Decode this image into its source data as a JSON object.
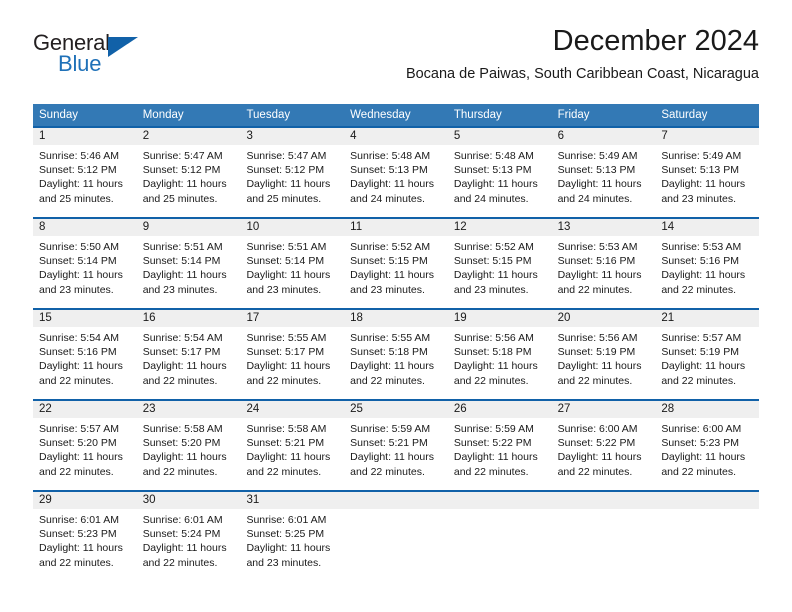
{
  "brand": {
    "name_top": "General",
    "name_bottom": "Blue",
    "accent_color": "#1161a8",
    "text_color": "#231f20"
  },
  "header": {
    "title": "December 2024",
    "subtitle": "Bocana de Paiwas, South Caribbean Coast, Nicaragua"
  },
  "theme": {
    "header_blue": "#3379b5",
    "rule_blue": "#1161a8",
    "daynum_band": "#efefef"
  },
  "weekdays": [
    "Sunday",
    "Monday",
    "Tuesday",
    "Wednesday",
    "Thursday",
    "Friday",
    "Saturday"
  ],
  "weeks": [
    {
      "days": [
        {
          "num": "1",
          "sunrise": "Sunrise: 5:46 AM",
          "sunset": "Sunset: 5:12 PM",
          "daylight1": "Daylight: 11 hours",
          "daylight2": "and 25 minutes."
        },
        {
          "num": "2",
          "sunrise": "Sunrise: 5:47 AM",
          "sunset": "Sunset: 5:12 PM",
          "daylight1": "Daylight: 11 hours",
          "daylight2": "and 25 minutes."
        },
        {
          "num": "3",
          "sunrise": "Sunrise: 5:47 AM",
          "sunset": "Sunset: 5:12 PM",
          "daylight1": "Daylight: 11 hours",
          "daylight2": "and 25 minutes."
        },
        {
          "num": "4",
          "sunrise": "Sunrise: 5:48 AM",
          "sunset": "Sunset: 5:13 PM",
          "daylight1": "Daylight: 11 hours",
          "daylight2": "and 24 minutes."
        },
        {
          "num": "5",
          "sunrise": "Sunrise: 5:48 AM",
          "sunset": "Sunset: 5:13 PM",
          "daylight1": "Daylight: 11 hours",
          "daylight2": "and 24 minutes."
        },
        {
          "num": "6",
          "sunrise": "Sunrise: 5:49 AM",
          "sunset": "Sunset: 5:13 PM",
          "daylight1": "Daylight: 11 hours",
          "daylight2": "and 24 minutes."
        },
        {
          "num": "7",
          "sunrise": "Sunrise: 5:49 AM",
          "sunset": "Sunset: 5:13 PM",
          "daylight1": "Daylight: 11 hours",
          "daylight2": "and 23 minutes."
        }
      ]
    },
    {
      "days": [
        {
          "num": "8",
          "sunrise": "Sunrise: 5:50 AM",
          "sunset": "Sunset: 5:14 PM",
          "daylight1": "Daylight: 11 hours",
          "daylight2": "and 23 minutes."
        },
        {
          "num": "9",
          "sunrise": "Sunrise: 5:51 AM",
          "sunset": "Sunset: 5:14 PM",
          "daylight1": "Daylight: 11 hours",
          "daylight2": "and 23 minutes."
        },
        {
          "num": "10",
          "sunrise": "Sunrise: 5:51 AM",
          "sunset": "Sunset: 5:14 PM",
          "daylight1": "Daylight: 11 hours",
          "daylight2": "and 23 minutes."
        },
        {
          "num": "11",
          "sunrise": "Sunrise: 5:52 AM",
          "sunset": "Sunset: 5:15 PM",
          "daylight1": "Daylight: 11 hours",
          "daylight2": "and 23 minutes."
        },
        {
          "num": "12",
          "sunrise": "Sunrise: 5:52 AM",
          "sunset": "Sunset: 5:15 PM",
          "daylight1": "Daylight: 11 hours",
          "daylight2": "and 23 minutes."
        },
        {
          "num": "13",
          "sunrise": "Sunrise: 5:53 AM",
          "sunset": "Sunset: 5:16 PM",
          "daylight1": "Daylight: 11 hours",
          "daylight2": "and 22 minutes."
        },
        {
          "num": "14",
          "sunrise": "Sunrise: 5:53 AM",
          "sunset": "Sunset: 5:16 PM",
          "daylight1": "Daylight: 11 hours",
          "daylight2": "and 22 minutes."
        }
      ]
    },
    {
      "days": [
        {
          "num": "15",
          "sunrise": "Sunrise: 5:54 AM",
          "sunset": "Sunset: 5:16 PM",
          "daylight1": "Daylight: 11 hours",
          "daylight2": "and 22 minutes."
        },
        {
          "num": "16",
          "sunrise": "Sunrise: 5:54 AM",
          "sunset": "Sunset: 5:17 PM",
          "daylight1": "Daylight: 11 hours",
          "daylight2": "and 22 minutes."
        },
        {
          "num": "17",
          "sunrise": "Sunrise: 5:55 AM",
          "sunset": "Sunset: 5:17 PM",
          "daylight1": "Daylight: 11 hours",
          "daylight2": "and 22 minutes."
        },
        {
          "num": "18",
          "sunrise": "Sunrise: 5:55 AM",
          "sunset": "Sunset: 5:18 PM",
          "daylight1": "Daylight: 11 hours",
          "daylight2": "and 22 minutes."
        },
        {
          "num": "19",
          "sunrise": "Sunrise: 5:56 AM",
          "sunset": "Sunset: 5:18 PM",
          "daylight1": "Daylight: 11 hours",
          "daylight2": "and 22 minutes."
        },
        {
          "num": "20",
          "sunrise": "Sunrise: 5:56 AM",
          "sunset": "Sunset: 5:19 PM",
          "daylight1": "Daylight: 11 hours",
          "daylight2": "and 22 minutes."
        },
        {
          "num": "21",
          "sunrise": "Sunrise: 5:57 AM",
          "sunset": "Sunset: 5:19 PM",
          "daylight1": "Daylight: 11 hours",
          "daylight2": "and 22 minutes."
        }
      ]
    },
    {
      "days": [
        {
          "num": "22",
          "sunrise": "Sunrise: 5:57 AM",
          "sunset": "Sunset: 5:20 PM",
          "daylight1": "Daylight: 11 hours",
          "daylight2": "and 22 minutes."
        },
        {
          "num": "23",
          "sunrise": "Sunrise: 5:58 AM",
          "sunset": "Sunset: 5:20 PM",
          "daylight1": "Daylight: 11 hours",
          "daylight2": "and 22 minutes."
        },
        {
          "num": "24",
          "sunrise": "Sunrise: 5:58 AM",
          "sunset": "Sunset: 5:21 PM",
          "daylight1": "Daylight: 11 hours",
          "daylight2": "and 22 minutes."
        },
        {
          "num": "25",
          "sunrise": "Sunrise: 5:59 AM",
          "sunset": "Sunset: 5:21 PM",
          "daylight1": "Daylight: 11 hours",
          "daylight2": "and 22 minutes."
        },
        {
          "num": "26",
          "sunrise": "Sunrise: 5:59 AM",
          "sunset": "Sunset: 5:22 PM",
          "daylight1": "Daylight: 11 hours",
          "daylight2": "and 22 minutes."
        },
        {
          "num": "27",
          "sunrise": "Sunrise: 6:00 AM",
          "sunset": "Sunset: 5:22 PM",
          "daylight1": "Daylight: 11 hours",
          "daylight2": "and 22 minutes."
        },
        {
          "num": "28",
          "sunrise": "Sunrise: 6:00 AM",
          "sunset": "Sunset: 5:23 PM",
          "daylight1": "Daylight: 11 hours",
          "daylight2": "and 22 minutes."
        }
      ]
    },
    {
      "days": [
        {
          "num": "29",
          "sunrise": "Sunrise: 6:01 AM",
          "sunset": "Sunset: 5:23 PM",
          "daylight1": "Daylight: 11 hours",
          "daylight2": "and 22 minutes."
        },
        {
          "num": "30",
          "sunrise": "Sunrise: 6:01 AM",
          "sunset": "Sunset: 5:24 PM",
          "daylight1": "Daylight: 11 hours",
          "daylight2": "and 22 minutes."
        },
        {
          "num": "31",
          "sunrise": "Sunrise: 6:01 AM",
          "sunset": "Sunset: 5:25 PM",
          "daylight1": "Daylight: 11 hours",
          "daylight2": "and 23 minutes."
        },
        {
          "num": "",
          "sunrise": "",
          "sunset": "",
          "daylight1": "",
          "daylight2": ""
        },
        {
          "num": "",
          "sunrise": "",
          "sunset": "",
          "daylight1": "",
          "daylight2": ""
        },
        {
          "num": "",
          "sunrise": "",
          "sunset": "",
          "daylight1": "",
          "daylight2": ""
        },
        {
          "num": "",
          "sunrise": "",
          "sunset": "",
          "daylight1": "",
          "daylight2": ""
        }
      ]
    }
  ]
}
